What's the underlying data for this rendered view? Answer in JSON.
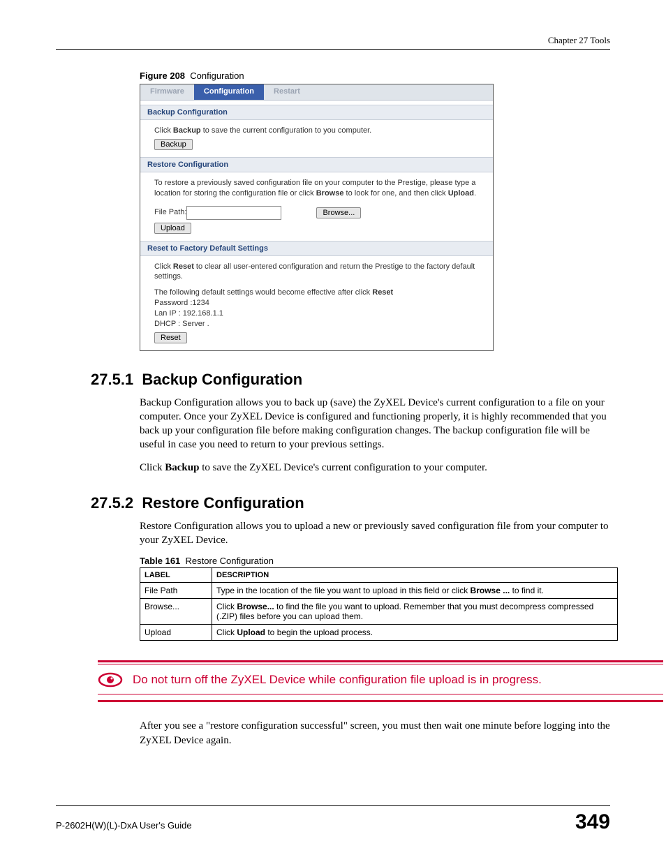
{
  "header": {
    "chapter": "Chapter 27 Tools"
  },
  "figure": {
    "label": "Figure 208",
    "title": "Configuration"
  },
  "screenshot": {
    "tabs": {
      "firmware": "Firmware",
      "configuration": "Configuration",
      "restart": "Restart"
    },
    "backup": {
      "heading": "Backup Configuration",
      "text_a": "Click ",
      "text_bold": "Backup",
      "text_b": " to save the current configuration to you computer.",
      "button": "Backup"
    },
    "restore": {
      "heading": "Restore Configuration",
      "text_a": "To restore a previously saved configuration file on your computer to the Prestige, please type a location for storing the configuration file or click ",
      "text_bold1": "Browse",
      "text_b": " to look for one, and then click ",
      "text_bold2": "Upload",
      "text_c": ".",
      "file_label": "File Path:",
      "browse_button": "Browse...",
      "upload_button": "Upload"
    },
    "reset": {
      "heading": "Reset to Factory Default Settings",
      "text1_a": "Click ",
      "text1_bold": "Reset",
      "text1_b": " to clear all user-entered configuration and return the Prestige to the factory default settings.",
      "text2_a": "The following default settings would become effective after click ",
      "text2_bold": "Reset",
      "line1": "Password :1234",
      "line2": "Lan IP : 192.168.1.1",
      "line3": "DHCP : Server .",
      "button": "Reset"
    }
  },
  "sections": {
    "s1": {
      "num": "27.5.1",
      "title": "Backup Configuration",
      "p1": "Backup Configuration allows you to back up (save) the ZyXEL Device's current configuration to a file on your computer. Once your ZyXEL Device is configured and functioning properly, it is highly recommended that you back up your configuration file before making configuration changes. The backup configuration file will be useful in case you need to return to your previous settings.",
      "p2_a": "Click ",
      "p2_bold": "Backup",
      "p2_b": " to save the ZyXEL Device's current configuration to your computer."
    },
    "s2": {
      "num": "27.5.2",
      "title": "Restore Configuration",
      "p1": "Restore Configuration allows you to upload a new or previously saved configuration file from your computer to your ZyXEL Device."
    }
  },
  "table": {
    "label": "Table 161",
    "title": "Restore Configuration",
    "head_label": "LABEL",
    "head_desc": "DESCRIPTION",
    "rows": [
      {
        "label": "File Path",
        "desc_a": "Type in the location of the file you want to upload in this field or click ",
        "desc_bold": "Browse ...",
        "desc_b": " to find it."
      },
      {
        "label": "Browse...",
        "desc_a": "Click ",
        "desc_bold": "Browse...",
        "desc_b": " to find the file you want to upload. Remember that you must decompress compressed (.ZIP) files before you can upload them."
      },
      {
        "label": "Upload",
        "desc_a": "Click ",
        "desc_bold": "Upload",
        "desc_b": " to begin the upload process."
      }
    ]
  },
  "warning": "Do not turn off the ZyXEL Device while configuration file upload is in progress.",
  "after_warning": "After you see a \"restore configuration successful\" screen, you must then wait one minute before logging into the ZyXEL Device again.",
  "footer": {
    "guide": "P-2602H(W)(L)-DxA User's Guide",
    "page": "349"
  }
}
